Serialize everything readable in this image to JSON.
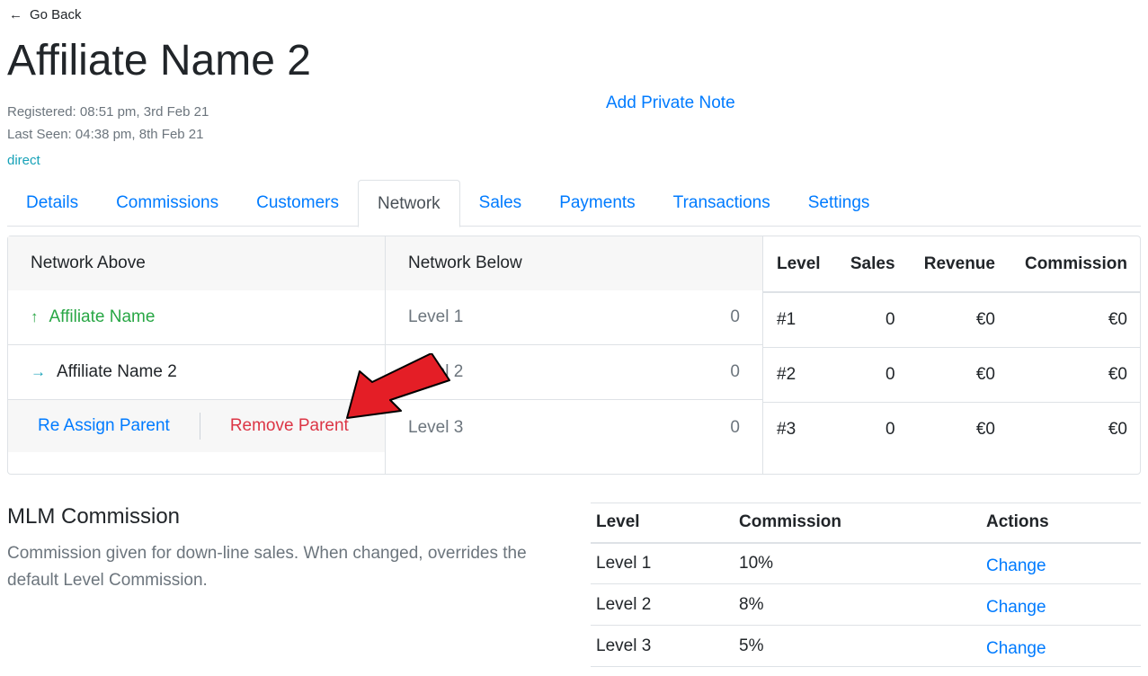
{
  "header": {
    "go_back": "Go Back",
    "title": "Affiliate Name 2",
    "registered": "Registered: 08:51 pm, 3rd Feb 21",
    "last_seen": "Last Seen: 04:38 pm, 8th Feb 21",
    "source": "direct",
    "add_note": "Add Private Note"
  },
  "tabs": [
    "Details",
    "Commissions",
    "Customers",
    "Network",
    "Sales",
    "Payments",
    "Transactions",
    "Settings"
  ],
  "active_tab": "Network",
  "network_above": {
    "heading": "Network Above",
    "parent": "Affiliate Name",
    "self": "Affiliate Name 2",
    "reassign_label": "Re Assign Parent",
    "remove_label": "Remove Parent"
  },
  "network_below": {
    "heading": "Network Below",
    "levels": [
      {
        "label": "Level 1",
        "count": "0"
      },
      {
        "label": "Level 2",
        "count": "0"
      },
      {
        "label": "Level 3",
        "count": "0"
      }
    ]
  },
  "stats": {
    "headers": [
      "Level",
      "Sales",
      "Revenue",
      "Commission"
    ],
    "rows": [
      [
        "#1",
        "0",
        "€0",
        "€0"
      ],
      [
        "#2",
        "0",
        "€0",
        "€0"
      ],
      [
        "#3",
        "0",
        "€0",
        "€0"
      ]
    ]
  },
  "mlm": {
    "title": "MLM Commission",
    "description": "Commission given for down-line sales. When changed, overrides the default Level Commission.",
    "headers": [
      "Level",
      "Commission",
      "Actions"
    ],
    "rows": [
      {
        "level": "Level 1",
        "commission": "10%",
        "action": "Change"
      },
      {
        "level": "Level 2",
        "commission": "8%",
        "action": "Change"
      },
      {
        "level": "Level 3",
        "commission": "5%",
        "action": "Change"
      }
    ]
  },
  "colors": {
    "link": "#007bff",
    "success": "#28a745",
    "danger": "#dc3545",
    "info": "#17a2b8",
    "annotation_arrow": "#e41e26"
  }
}
